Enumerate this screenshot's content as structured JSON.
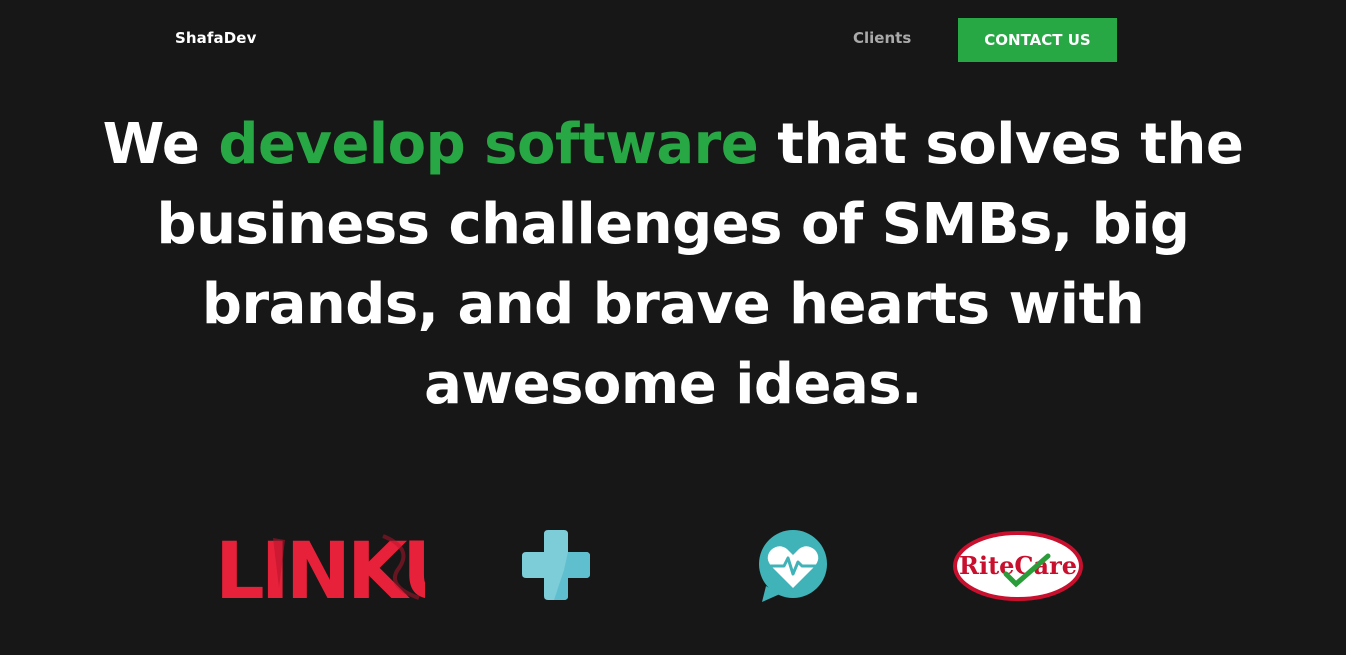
{
  "header": {
    "brand": "ShafaDev",
    "nav_clients": "Clients",
    "contact_label": "CONTACT US"
  },
  "hero": {
    "part1": "We ",
    "accent": "develop software",
    "part2": " that solves the business challenges of SMBs, big brands, and brave hearts with awesome ideas."
  },
  "clients": {
    "linkus_text": "LINKUS",
    "ritecare_text": "RiteCare",
    "logos": [
      "linkus-logo",
      "medical-cross-logo",
      "heart-chat-logo",
      "ritecare-logo"
    ]
  },
  "colors": {
    "background": "#171717",
    "accent": "#28a745",
    "text": "#ffffff",
    "nav_text": "#aaaaaa"
  }
}
